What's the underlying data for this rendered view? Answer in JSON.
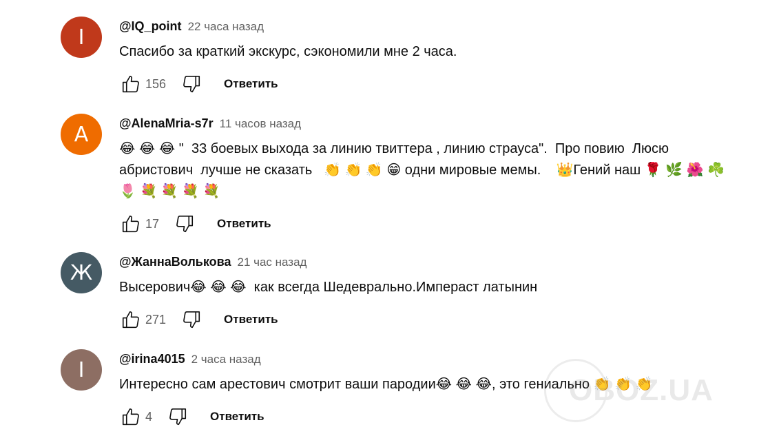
{
  "comments": [
    {
      "avatar_letter": "I",
      "avatar_color": "#c0391b",
      "handle": "@IQ_point",
      "time": "22 часа назад",
      "text": "Спасибо за краткий экскурс, сэкономили мне 2 часа.",
      "likes": "156",
      "reply_label": "Ответить"
    },
    {
      "avatar_letter": "A",
      "avatar_color": "#ef6c00",
      "handle": "@AlenaMria-s7r",
      "time": "11 часов назад",
      "text": "😂 😂 😂 \"  33 боевых выхода за линию твиттера , линию страуса\".  Про повию  Люсю абристович  лучше не сказать   👏 👏 👏 😁 одни мировые мемы.    👑Гений наш 🌹 🌿 🌺 ☘️ 🌷 💐 💐 💐 💐",
      "likes": "17",
      "reply_label": "Ответить"
    },
    {
      "avatar_letter": "Ж",
      "avatar_color": "#455a64",
      "handle": "@ЖаннаВолькова",
      "time": "21 час назад",
      "text": "Высерович😂 😂 😂  как всегда Шедеврально.Имперaст латынин",
      "likes": "271",
      "reply_label": "Ответить"
    },
    {
      "avatar_letter": "I",
      "avatar_color": "#8d6e63",
      "handle": "@irina4015",
      "time": "2 часа назад",
      "text": "Интересно сам арестович смотрит ваши пародии😂 😂 😂, это гениально 👏 👏 👏",
      "likes": "4",
      "reply_label": "Ответить"
    }
  ],
  "watermark": "OBOZ.UA"
}
